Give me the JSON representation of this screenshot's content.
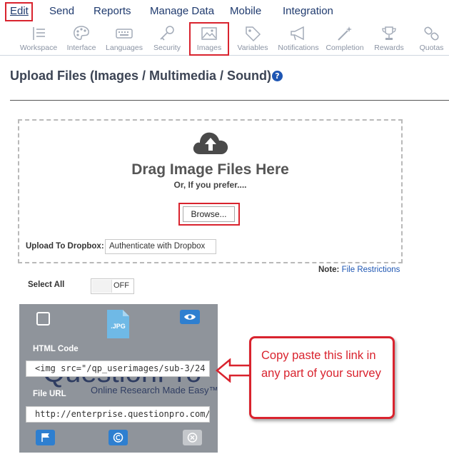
{
  "topnav": {
    "items": [
      "Edit",
      "Send",
      "Reports",
      "Manage Data",
      "Mobile",
      "Integration"
    ]
  },
  "toolbar": {
    "items": [
      {
        "label": "Workspace",
        "icon": "workspace-icon"
      },
      {
        "label": "Interface",
        "icon": "palette-icon"
      },
      {
        "label": "Languages",
        "icon": "keyboard-icon"
      },
      {
        "label": "Security",
        "icon": "key-icon"
      },
      {
        "label": "Images",
        "icon": "image-icon"
      },
      {
        "label": "Variables",
        "icon": "tag-icon"
      },
      {
        "label": "Notifications",
        "icon": "megaphone-icon"
      },
      {
        "label": "Completion",
        "icon": "magic-wand-icon"
      },
      {
        "label": "Rewards",
        "icon": "trophy-icon"
      },
      {
        "label": "Quotas",
        "icon": "link-icon"
      }
    ],
    "active": "Images"
  },
  "page": {
    "title": "Upload Files (Images / Multimedia / Sound)",
    "help": "?"
  },
  "dropzone": {
    "title": "Drag Image Files Here",
    "subtitle": "Or, If you prefer....",
    "browse_label": "Browse...",
    "dropbox_label": "Upload To Dropbox:",
    "dropbox_button": "Authenticate with Dropbox"
  },
  "note": {
    "prefix": "Note:",
    "link": "File Restrictions"
  },
  "select_all": {
    "label": "Select All",
    "state": "OFF"
  },
  "card": {
    "file_type": ".JPG",
    "html_code_label": "HTML Code",
    "html_code_value": "<img src=\"/qp_userimages/sub-3/24",
    "file_url_label": "File URL",
    "file_url_value": "http://enterprise.questionpro.com/",
    "logo_text": "QuestionPro",
    "logo_tagline": "Online Research Made Easy™"
  },
  "callout": {
    "text": "Copy paste this link in any part of your survey"
  },
  "colors": {
    "nav_text": "#1f3a6e",
    "highlight": "#d9232e",
    "accent_blue": "#2e7fd0",
    "card_bg": "#8f949b"
  }
}
